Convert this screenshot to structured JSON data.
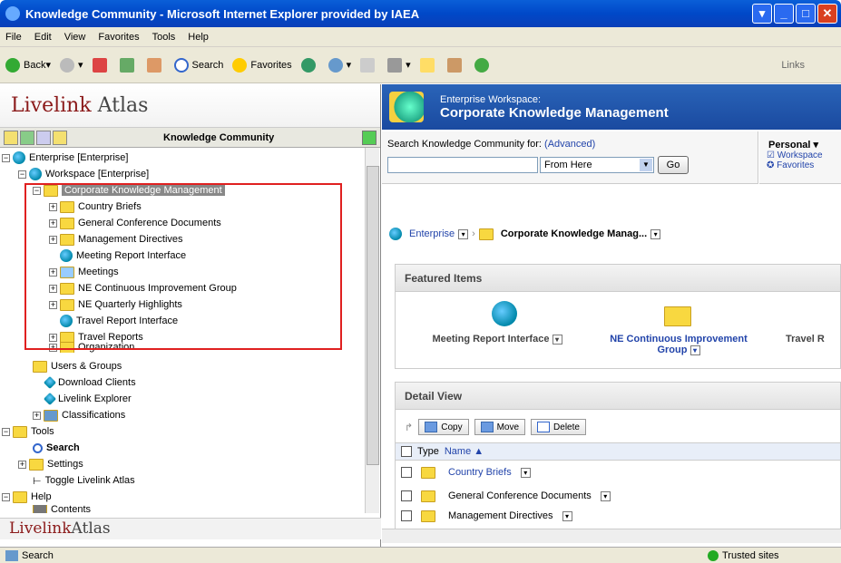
{
  "window": {
    "title": "Knowledge Community - Microsoft Internet Explorer provided by IAEA"
  },
  "menu": [
    "File",
    "Edit",
    "View",
    "Favorites",
    "Tools",
    "Help"
  ],
  "toolbar": {
    "back": "Back",
    "search": "Search",
    "favorites": "Favorites",
    "links": "Links"
  },
  "left": {
    "logo_a": "Livelink",
    "logo_b": "Atlas",
    "tree_title": "Knowledge Community",
    "nodes": {
      "enterprise": "Enterprise [Enterprise]",
      "workspace": "Workspace [Enterprise]",
      "ckm": "Corporate Knowledge Management",
      "country": "Country Briefs",
      "gcd": "General Conference Documents",
      "md": "Management Directives",
      "mri": "Meeting Report Interface",
      "meetings": "Meetings",
      "necig": "NE Continuous Improvement Group",
      "neqh": "NE Quarterly Highlights",
      "tri": "Travel Report Interface",
      "tr": "Travel Reports",
      "org": "Organization",
      "ug": "Users & Groups",
      "dc": "Download Clients",
      "le": "Livelink Explorer",
      "cls": "Classifications",
      "tools": "Tools",
      "search": "Search",
      "settings": "Settings",
      "toggle": "Toggle Livelink Atlas",
      "help": "Help",
      "contents": "Contents"
    },
    "footer_a": "Livelink",
    "footer_b": "Atlas"
  },
  "right": {
    "ws_label": "Enterprise Workspace:",
    "ws_title": "Corporate Knowledge Management",
    "search_label": "Search Knowledge Community for:",
    "advanced": "(Advanced)",
    "scope": "From Here",
    "go": "Go",
    "personal": "Personal",
    "workspace_link": "Workspace",
    "favorites_link": "Favorites",
    "crumb_a": "Enterprise",
    "crumb_b": "Corporate Knowledge Manag...",
    "featured_title": "Featured Items",
    "featured": [
      "Meeting Report Interface",
      "NE Continuous Improvement Group",
      "Travel R"
    ],
    "detail_title": "Detail View",
    "copy": "Copy",
    "move": "Move",
    "delete": "Delete",
    "col_type": "Type",
    "col_name": "Name",
    "rows": [
      "Country Briefs",
      "General Conference Documents",
      "Management Directives"
    ]
  },
  "status": {
    "left": "Search",
    "zone": "Trusted sites"
  }
}
